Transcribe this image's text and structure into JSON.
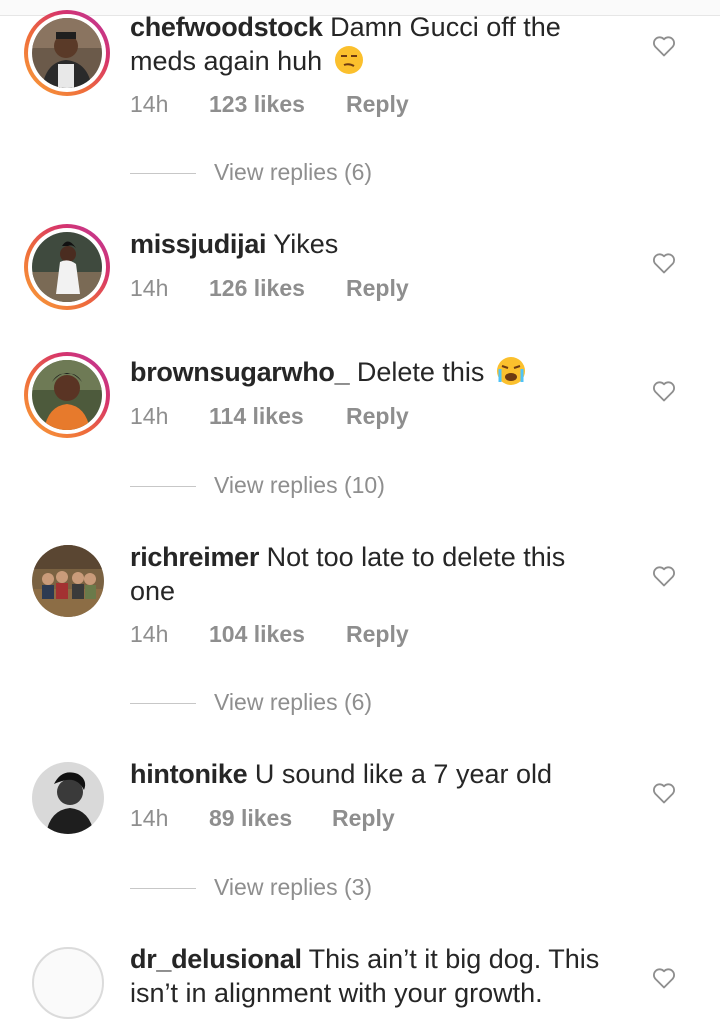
{
  "colors": {
    "meta_gray": "#8e8e8e",
    "text": "#262626",
    "story_ring": "#d6336c"
  },
  "comments": [
    {
      "username": "chefwoodstock",
      "text": "Damn Gucci off the meds again huh",
      "emoji": "unamused-face",
      "time": "14h",
      "likes": "123 likes",
      "reply": "Reply",
      "view_replies": "View replies (6)"
    },
    {
      "username": "missjudijai",
      "text": "Yikes",
      "time": "14h",
      "likes": "126 likes",
      "reply": "Reply"
    },
    {
      "username": "brownsugarwho_",
      "text": "Delete this",
      "emoji": "loudly-crying-face",
      "time": "14h",
      "likes": "114 likes",
      "reply": "Reply",
      "view_replies": "View replies (10)"
    },
    {
      "username": "richreimer",
      "text": "Not too late to delete this one",
      "time": "14h",
      "likes": "104 likes",
      "reply": "Reply",
      "view_replies": "View replies (6)"
    },
    {
      "username": "hintonike",
      "text": "U sound like a 7 year old",
      "time": "14h",
      "likes": "89 likes",
      "reply": "Reply",
      "view_replies": "View replies (3)"
    },
    {
      "username": "dr_delusional",
      "text": "This ain’t it big dog. This isn’t in alignment with your growth."
    }
  ]
}
